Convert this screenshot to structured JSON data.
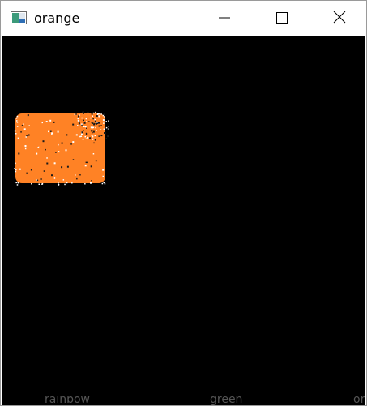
{
  "window": {
    "title": "orange",
    "icon": "image-window-icon"
  },
  "titlebar_buttons": {
    "minimize_icon": "minimize-icon",
    "maximize_icon": "maximize-icon",
    "close_icon": "close-icon"
  },
  "canvas": {
    "background_color": "#000000",
    "blob_color": "#ff8225",
    "speckle_color": "#ffffff",
    "shape": "orange-rectangle-blob"
  },
  "background_window": {
    "items": [
      "rainbow",
      "green",
      "or"
    ]
  }
}
